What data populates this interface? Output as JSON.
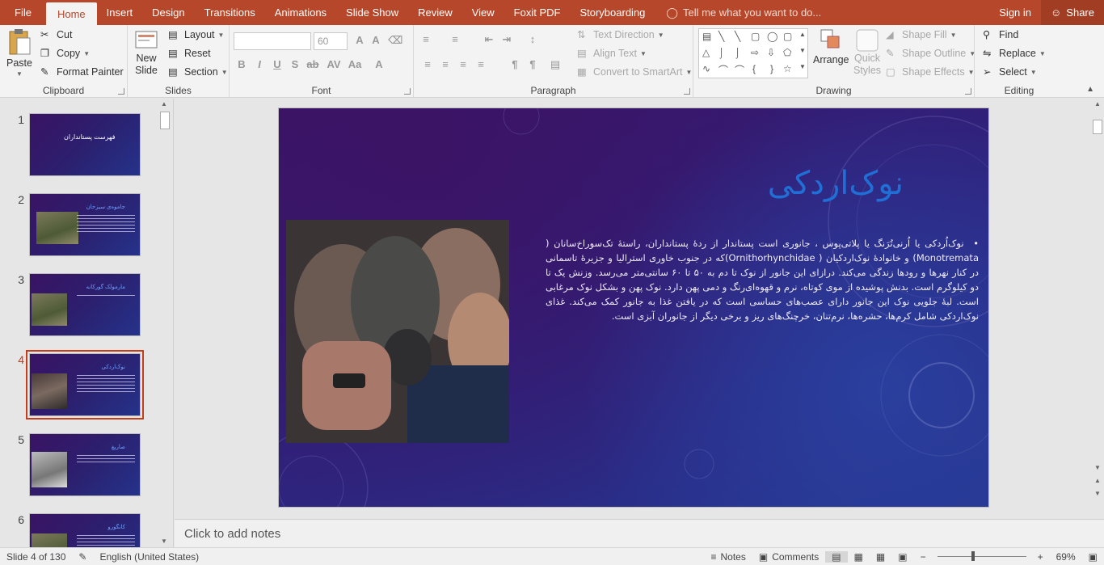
{
  "tabs": [
    "File",
    "Home",
    "Insert",
    "Design",
    "Transitions",
    "Animations",
    "Slide Show",
    "Review",
    "View",
    "Foxit PDF",
    "Storyboarding"
  ],
  "active_tab": "Home",
  "tell_me": "Tell me what you want to do...",
  "sign_in": "Sign in",
  "share": "Share",
  "clipboard": {
    "paste": "Paste",
    "cut": "Cut",
    "copy": "Copy",
    "format_painter": "Format Painter",
    "label": "Clipboard"
  },
  "slides_group": {
    "new_slide_1": "New",
    "new_slide_2": "Slide",
    "layout": "Layout",
    "reset": "Reset",
    "section": "Section",
    "label": "Slides"
  },
  "font_group": {
    "font_name": "",
    "font_size": "60",
    "label": "Font"
  },
  "paragraph_group": {
    "text_direction": "Text Direction",
    "align_text": "Align Text",
    "smartart": "Convert to SmartArt",
    "label": "Paragraph"
  },
  "drawing_group": {
    "arrange": "Arrange",
    "quick_styles_1": "Quick",
    "quick_styles_2": "Styles",
    "shape_fill": "Shape Fill",
    "shape_outline": "Shape Outline",
    "shape_effects": "Shape Effects",
    "label": "Drawing"
  },
  "editing_group": {
    "find": "Find",
    "replace": "Replace",
    "select": "Select",
    "label": "Editing"
  },
  "thumbnails": [
    {
      "num": "1",
      "title": "فهرست پستانداران"
    },
    {
      "num": "2",
      "title": "جاموه‌ی سیزحان"
    },
    {
      "num": "3",
      "title": "مارمولک گورکانه"
    },
    {
      "num": "4",
      "title": "نوک‌اردکی"
    },
    {
      "num": "5",
      "title": "صاریغ"
    },
    {
      "num": "6",
      "title": "کانگورو"
    }
  ],
  "slide": {
    "title": "نوک‌اردکی",
    "body": "نوک‌اُردکی یا اُرنی‌تُرَنگ یا پلاتی‌پوس ، جانوری است پستاندار از ردهٔ پستانداران، راستهٔ تک‌سوراخ‌سانان ( Monotremata) و خانوادهٔ نوک‌اردکیان ( Ornithorhynchidae)که در جنوب خاوری استرالیا و جزیرهٔ تاسمانی در کنار نهرها و رودها زندگی می‌کند. درازای این جانور از نوک تا دم به ۵۰ تا ۶۰ سانتی‌متر می‌رسد. وزنش یک تا دو کیلوگرم است. بدنش پوشیده از موی کوتاه، نرم و قهوه‌ای‌رنگ و دمی پهن دارد. نوک پهن و بشکل نوک مرغابی است. لبهٔ جلویی نوک این جانور دارای عصب‌های حساسی است که در یافتن غذا به جانور کمک می‌کند. غذای نوک‌اردکی شامل کرم‌ها، حشره‌ها، نرم‌تنان، خرچنگ‌های ریز و برخی دیگر از جانوران آبزی است."
  },
  "notes_placeholder": "Click to add notes",
  "status": {
    "slide_info": "Slide 4 of 130",
    "language": "English (United States)",
    "notes": "Notes",
    "comments": "Comments",
    "zoom": "69%"
  },
  "colors": {
    "accent": "#b7472a",
    "slide_title": "#1f6fd6"
  }
}
